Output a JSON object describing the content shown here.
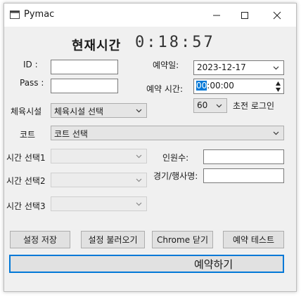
{
  "window": {
    "title": "Pymac"
  },
  "clock": {
    "label": "현재시간",
    "time": "0:18:57"
  },
  "form": {
    "id_label": "ID :",
    "id_value": "",
    "pass_label": "Pass :",
    "pass_value": "",
    "reserve_date_label": "예약일:",
    "reserve_date_value": "2023-12-17",
    "reserve_time_label": "예약 시간:",
    "reserve_time_hh": "00",
    "reserve_time_rest": ":00:00",
    "seconds_value": "60",
    "login_before_label": "초전 로그인",
    "facility_label": "체육시설",
    "facility_value": "체육시설 선택",
    "court_label": "코트",
    "court_value": "코트 선택",
    "slot1_label": "시간 선택1",
    "slot2_label": "시간 선택2",
    "slot3_label": "시간 선택3",
    "people_label": "인원수:",
    "people_value": "",
    "event_label": "경기/행사명:",
    "event_value": ""
  },
  "buttons": {
    "save": "설정 저장",
    "load": "설정 불러오기",
    "chrome_close": "Chrome 닫기",
    "test": "예약 테스트",
    "reserve": "예약하기"
  },
  "icons": [
    "app-icon",
    "minimize-icon",
    "maximize-icon",
    "close-icon",
    "chevron-down-icon",
    "spin-up-icon",
    "spin-down-icon"
  ]
}
